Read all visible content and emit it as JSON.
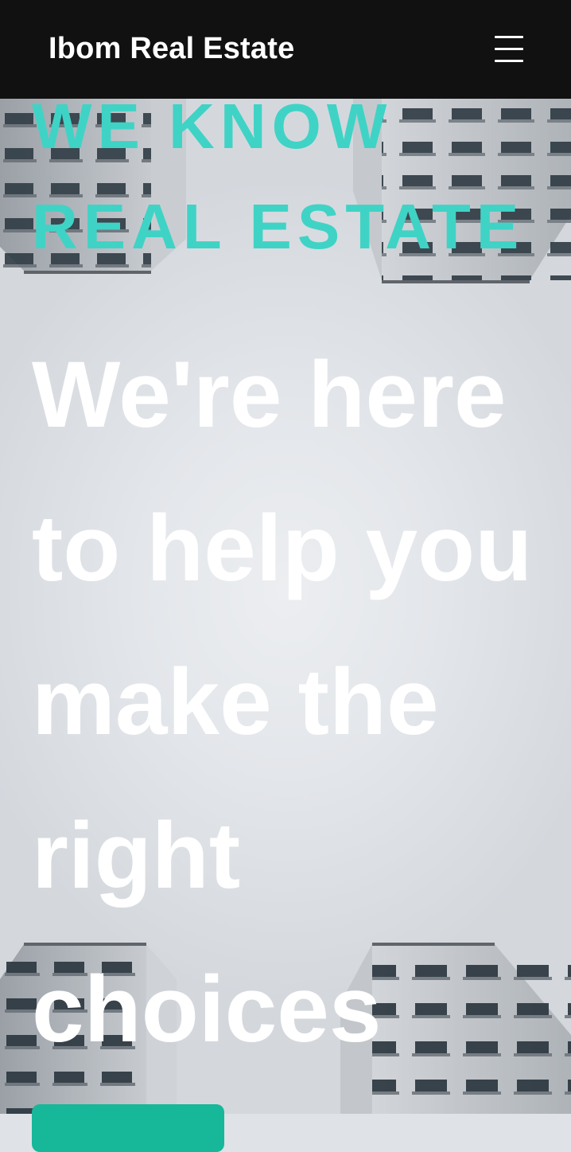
{
  "navbar": {
    "brand": "Ibom Real Estate",
    "menu_icon": "hamburger-menu-icon"
  },
  "hero": {
    "eyebrow": "WE KNOW REAL ESTATE",
    "headline": "We're here to help you make the right choices",
    "cta_label": "",
    "background": "looking-up-between-apartment-towers-photo"
  },
  "colors": {
    "navbar_bg": "#111111",
    "accent": "#3fd3c6",
    "cta": "#17b79a",
    "text_on_hero": "#ffffff"
  }
}
